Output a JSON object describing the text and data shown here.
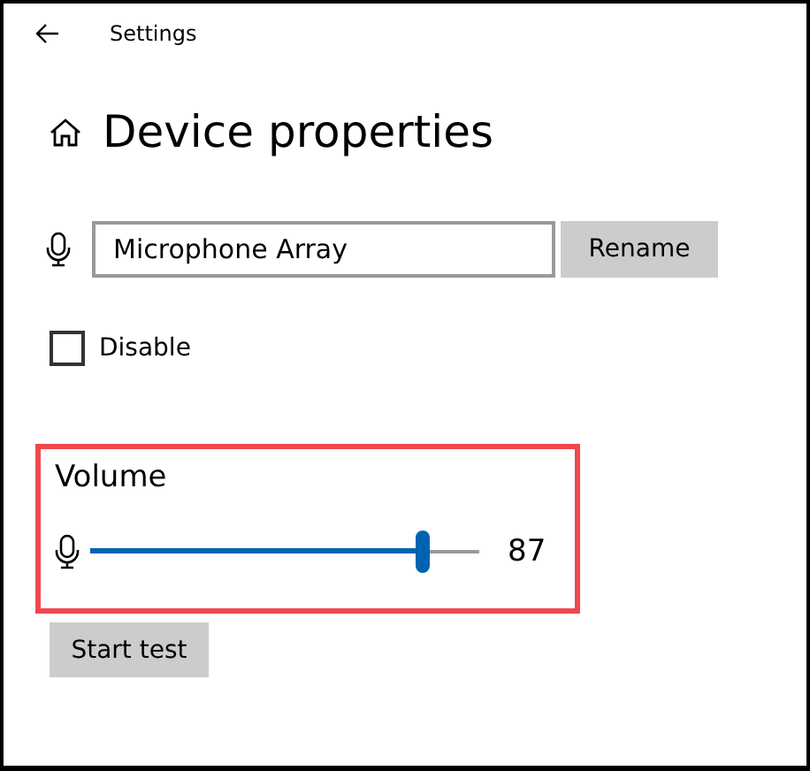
{
  "window": {
    "title": "Settings"
  },
  "heading": "Device properties",
  "device_name": {
    "value": "Microphone Array"
  },
  "rename_button": "Rename",
  "disable": {
    "label": "Disable",
    "checked": false
  },
  "volume": {
    "title": "Volume",
    "level": 0.855,
    "reading": "87"
  },
  "test_button": "Start test"
}
